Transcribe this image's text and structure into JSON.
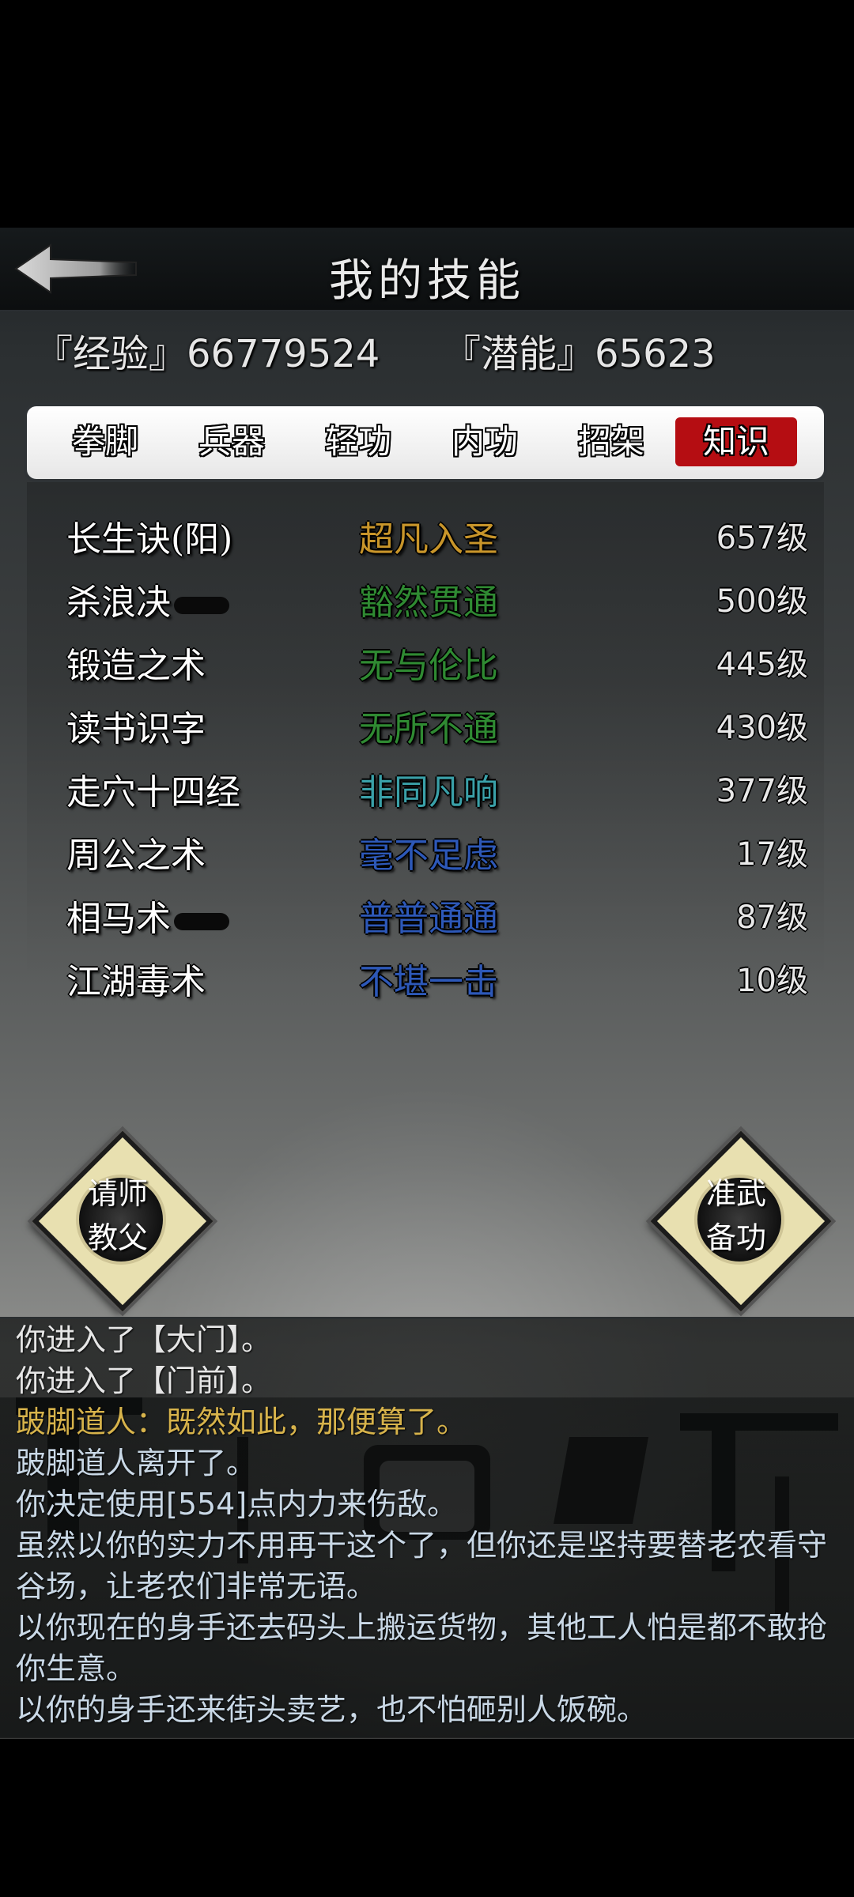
{
  "header": {
    "title": "我的技能",
    "back_icon": "arrow-left-icon"
  },
  "stats": {
    "exp_label": "『经验』",
    "exp_value": "66779524",
    "potential_label": "『潜能』",
    "potential_value": "65623"
  },
  "tabs": [
    {
      "label": "拳脚",
      "active": false
    },
    {
      "label": "兵器",
      "active": false
    },
    {
      "label": "轻功",
      "active": false
    },
    {
      "label": "内功",
      "active": false
    },
    {
      "label": "招架",
      "active": false
    },
    {
      "label": "知识",
      "active": true
    }
  ],
  "skills": [
    {
      "name": "长生诀(阳)",
      "rank": "超凡入圣",
      "level": "657级",
      "rank_color": "#c8952a"
    },
    {
      "name": "杀浪决",
      "rank": "豁然贯通",
      "level": "500级",
      "rank_color": "#2f8a32"
    },
    {
      "name": "锻造之术",
      "rank": "无与伦比",
      "level": "445级",
      "rank_color": "#2f8a32"
    },
    {
      "name": "读书识字",
      "rank": "无所不通",
      "level": "430级",
      "rank_color": "#2f8a32"
    },
    {
      "name": "走穴十四经",
      "rank": "非同凡响",
      "level": "377级",
      "rank_color": "#3aa0a8"
    },
    {
      "name": "周公之术",
      "rank": "毫不足虑",
      "level": "17级",
      "rank_color": "#2d58b8"
    },
    {
      "name": "相马术",
      "rank": "普普通通",
      "level": "87级",
      "rank_color": "#2d58b8"
    },
    {
      "name": "江湖毒术",
      "rank": "不堪一击",
      "level": "10级",
      "rank_color": "#2d58b8"
    }
  ],
  "buttons": {
    "teacher_label": "请师\n教父",
    "prepare_label": "准武\n备功"
  },
  "log": [
    {
      "text": "你进入了【大门】。",
      "type": "first"
    },
    {
      "text": "你进入了【门前】。",
      "type": "first"
    },
    {
      "text": "跛脚道人：既然如此，那便算了。",
      "type": "npc"
    },
    {
      "text": "跛脚道人离开了。",
      "type": "sys"
    },
    {
      "text": "你决定使用[554]点内力来伤敌。",
      "type": "sys"
    },
    {
      "text": "虽然以你的实力不用再干这个了，但你还是坚持要替老农看守谷场，让老农们非常无语。",
      "type": "sys"
    },
    {
      "text": "以你现在的身手还去码头上搬运货物，其他工人怕是都不敢抢你生意。",
      "type": "sys"
    },
    {
      "text": "以你的身手还来街头卖艺，也不怕砸别人饭碗。",
      "type": "sys"
    }
  ],
  "colors": {
    "active_tab": "#b50d12",
    "npc_text": "#d7b34b",
    "log_text": "#c9d8e6"
  }
}
